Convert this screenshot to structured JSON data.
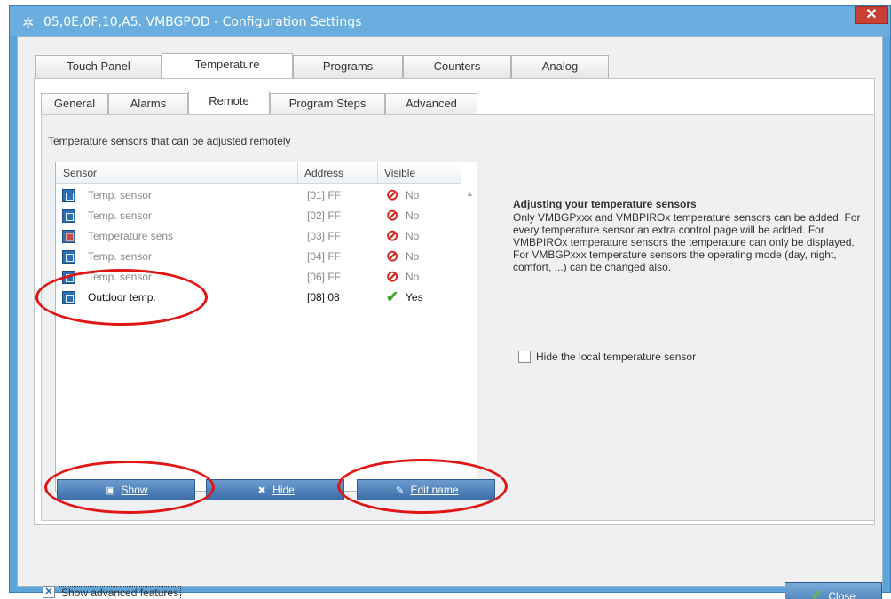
{
  "window": {
    "title": "05,0E,0F,10,A5. VMBGPOD - Configuration Settings",
    "close_glyph": "✕"
  },
  "tabs": [
    "Touch Panel",
    "Temperature",
    "Programs",
    "Counters",
    "Analog"
  ],
  "active_tab": "Temperature",
  "subtabs": [
    "General",
    "Alarms",
    "Remote",
    "Program Steps",
    "Advanced"
  ],
  "active_subtab": "Remote",
  "caption": "Temperature sensors that can be adjusted remotely",
  "table": {
    "headers": [
      "Sensor",
      "Address",
      "Visible"
    ],
    "rows": [
      {
        "name": "Temp. sensor",
        "address": "[01] FF",
        "visible": "No",
        "icon": "touch-panel-icon"
      },
      {
        "name": "Temp. sensor",
        "address": "[02] FF",
        "visible": "No",
        "icon": "thermostat-icon"
      },
      {
        "name": "Temperature sens",
        "address": "[03] FF",
        "visible": "No",
        "icon": "temperature-icon"
      },
      {
        "name": "Temp. sensor",
        "address": "[04] FF",
        "visible": "No",
        "icon": "touch-panel-icon"
      },
      {
        "name": "Temp. sensor",
        "address": "[06] FF",
        "visible": "No",
        "icon": "touch-panel-icon"
      },
      {
        "name": "Outdoor temp.",
        "address": "[08] 08",
        "visible": "Yes",
        "icon": "outdoor-sensor-icon"
      }
    ]
  },
  "buttons": {
    "show": "Show",
    "hide": "Hide",
    "edit_name": "Edit name"
  },
  "info": {
    "title": "Adjusting your temperature sensors",
    "body": "Only VMBGPxxx and VMBPIROx temperature sensors can be added. For every temperature sensor an extra control page will be added. For VMBPIROx temperature sensors the temperature can only be displayed. For VMBGPxxx temperature sensors the operating mode (day, night, comfort, ...) can be changed also."
  },
  "hide_local": {
    "label": "Hide the local temperature sensor",
    "checked": false
  },
  "advanced": {
    "label": "Show advanced features",
    "checked": true
  },
  "close_button": "Close",
  "colors": {
    "title_bar": "#6aaee0",
    "button": "#3c6ea9",
    "annotation": "#e01515",
    "no_icon": "#d1261e",
    "yes_icon": "#4aa332"
  }
}
